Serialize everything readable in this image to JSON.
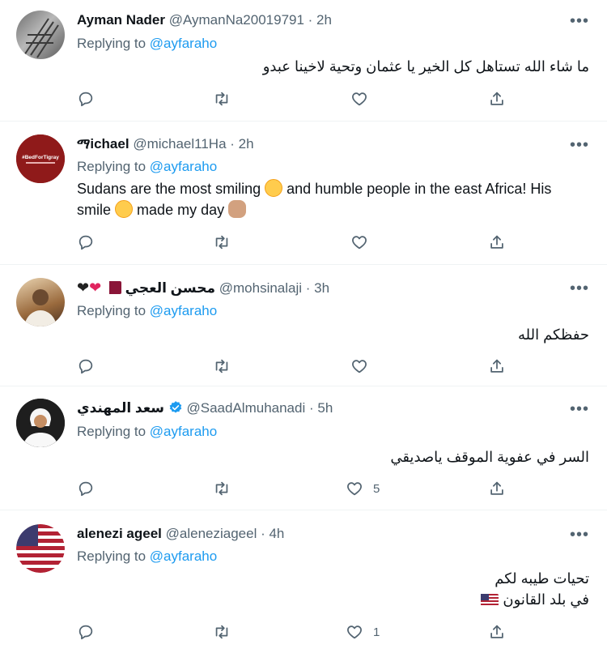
{
  "tweets": [
    {
      "name": "Ayman Nader",
      "handle": "@AymanNa20019791",
      "time": "· 2h",
      "replying_prefix": "Replying to",
      "replying_to": "@ayfaraho",
      "text": "ما شاء الله تستاهل كل الخير يا عثمان وتحية لاخينا عبدو",
      "likes": "",
      "avatar_color": "#8a8a8a"
    },
    {
      "name": "ማichael",
      "handle": "@michael11Ha",
      "time": "· 2h",
      "replying_prefix": "Replying to",
      "replying_to": "@ayfaraho",
      "text_parts": [
        "Sudans are the most smiling",
        "and humble people in the east Africa! His smile",
        "made my day"
      ],
      "avatar_text": "#BedForTigray",
      "avatar_color": "#9b1c1c",
      "likes": ""
    },
    {
      "name": "محسن العجي",
      "handle": "@mohsinalaji",
      "time": "· 3h",
      "replying_prefix": "Replying to",
      "replying_to": "@ayfaraho",
      "text": "حفظكم الله",
      "likes": "",
      "avatar_color": "#b5895a"
    },
    {
      "name": "سعد المهندي",
      "handle": "@SaadAlmuhanadi",
      "time": "· 5h",
      "replying_prefix": "Replying to",
      "replying_to": "@ayfaraho",
      "text": "السر في عفوية الموقف ياصديقي",
      "likes": "5",
      "avatar_color": "#1a1a1a"
    },
    {
      "name": "alenezi ageel",
      "handle": "@aleneziageel",
      "time": "· 4h",
      "replying_prefix": "Replying to",
      "replying_to": "@ayfaraho",
      "text_line1": "تحيات طيبه لكم",
      "text_line2": "في بلد القانون",
      "likes": "1",
      "avatar_color": "#b22234"
    }
  ],
  "icons": {
    "reply": "reply-icon",
    "retweet": "retweet-icon",
    "like": "heart-icon",
    "share": "share-icon",
    "more": "more-icon"
  },
  "colors": {
    "link": "#1d9bf0",
    "muted": "#536471",
    "text": "#0f1419",
    "verified": "#1d9bf0"
  }
}
